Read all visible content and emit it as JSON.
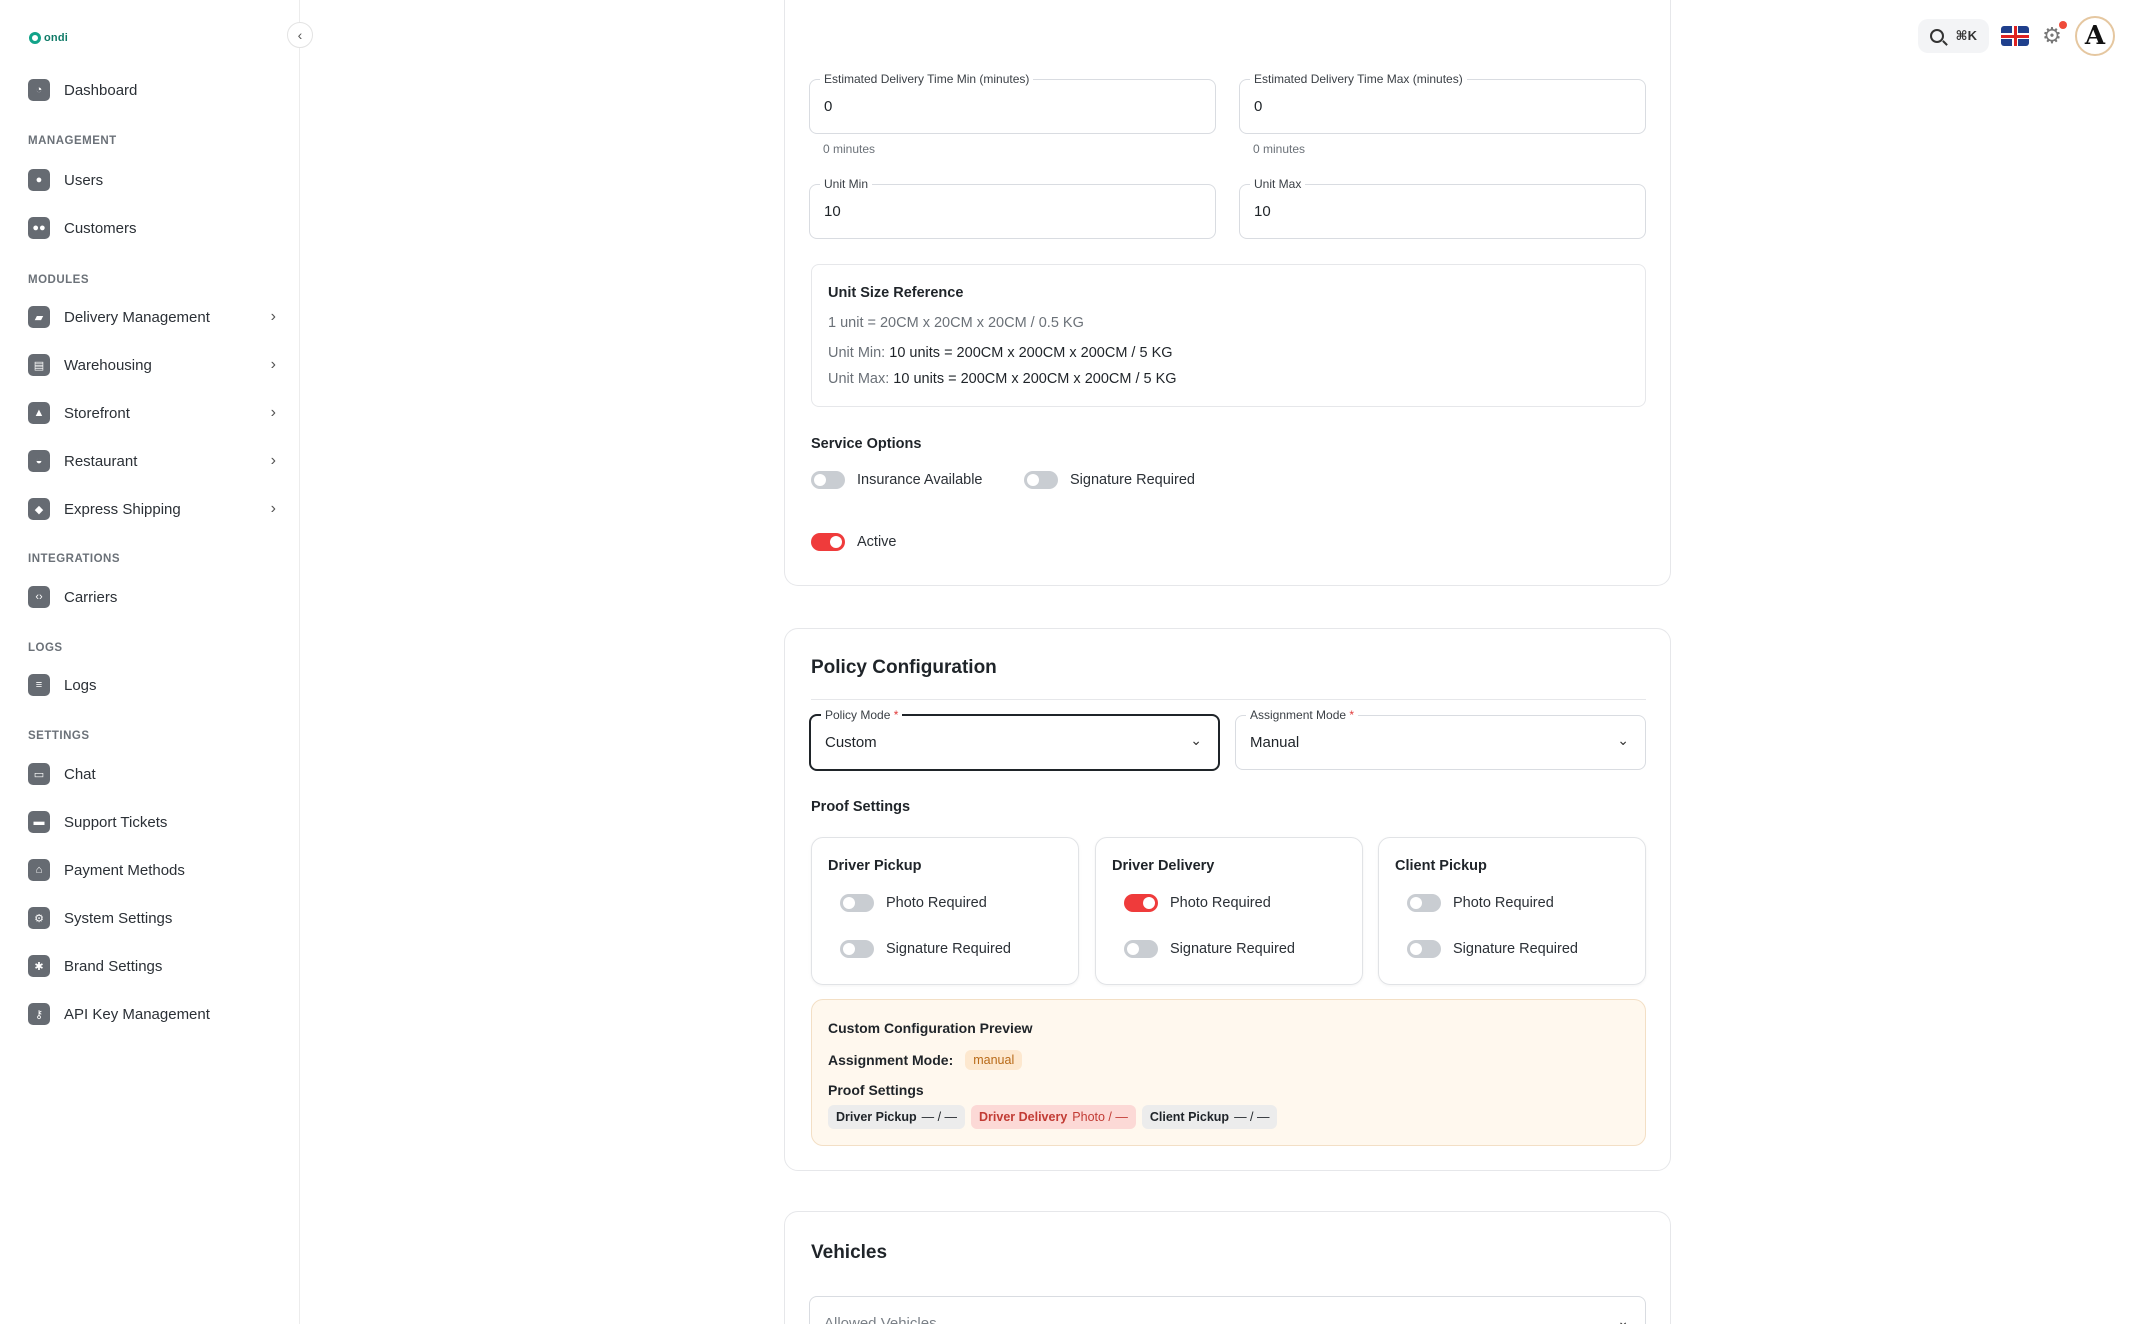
{
  "brand": {
    "name": "ondi"
  },
  "sidebar": {
    "dashboard": "Dashboard",
    "sections": {
      "management": "MANAGEMENT",
      "modules": "MODULES",
      "integrations": "INTEGRATIONS",
      "logs": "LOGS",
      "settings": "SETTINGS"
    },
    "items": {
      "users": "Users",
      "customers": "Customers",
      "delivery_management": "Delivery Management",
      "warehousing": "Warehousing",
      "storefront": "Storefront",
      "restaurant": "Restaurant",
      "express_shipping": "Express Shipping",
      "carriers": "Carriers",
      "logs": "Logs",
      "chat": "Chat",
      "support_tickets": "Support Tickets",
      "payment_methods": "Payment Methods",
      "system_settings": "System Settings",
      "brand_settings": "Brand Settings",
      "api_key_management": "API Key Management"
    }
  },
  "topbar": {
    "shortcut": "⌘K"
  },
  "service": {
    "delivery_min": {
      "label": "Estimated Delivery Time Min (minutes)",
      "value": "0",
      "helper": "0 minutes"
    },
    "delivery_max": {
      "label": "Estimated Delivery Time Max (minutes)",
      "value": "0",
      "helper": "0 minutes"
    },
    "unit_min": {
      "label": "Unit Min",
      "value": "10"
    },
    "unit_max": {
      "label": "Unit Max",
      "value": "10"
    },
    "unit_reference": {
      "title": "Unit Size Reference",
      "base": "1 unit = 20CM x 20CM x 20CM / 0.5 KG",
      "min_label": "Unit Min:",
      "min_value": "10 units = 200CM x 200CM x 200CM / 5 KG",
      "max_label": "Unit Max:",
      "max_value": "10 units = 200CM x 200CM x 200CM / 5 KG"
    },
    "service_options_title": "Service Options",
    "insurance": {
      "label": "Insurance Available",
      "on": false
    },
    "signature": {
      "label": "Signature Required",
      "on": false
    },
    "active": {
      "label": "Active",
      "on": true
    }
  },
  "policy": {
    "title": "Policy Configuration",
    "policy_mode": {
      "label": "Policy Mode",
      "required": "*",
      "value": "Custom"
    },
    "assignment_mode": {
      "label": "Assignment Mode",
      "required": "*",
      "value": "Manual"
    },
    "proof_settings_title": "Proof Settings",
    "proof": [
      {
        "title": "Driver Pickup",
        "photo_label": "Photo Required",
        "photo_on": false,
        "sig_label": "Signature Required",
        "sig_on": false
      },
      {
        "title": "Driver Delivery",
        "photo_label": "Photo Required",
        "photo_on": true,
        "sig_label": "Signature Required",
        "sig_on": false
      },
      {
        "title": "Client Pickup",
        "photo_label": "Photo Required",
        "photo_on": false,
        "sig_label": "Signature Required",
        "sig_on": false
      }
    ],
    "preview": {
      "title": "Custom Configuration Preview",
      "assignment_label": "Assignment Mode:",
      "assignment_value": "manual",
      "proof_title": "Proof Settings",
      "chips": [
        {
          "name": "Driver Pickup",
          "value": "— / —"
        },
        {
          "name": "Driver Delivery",
          "value": "Photo / —"
        },
        {
          "name": "Client Pickup",
          "value": "— / —"
        }
      ]
    }
  },
  "vehicles": {
    "title": "Vehicles",
    "allowed_placeholder": "Allowed Vehicles"
  },
  "colors": {
    "accent": "#ef3b3b",
    "brand": "#12a389"
  }
}
